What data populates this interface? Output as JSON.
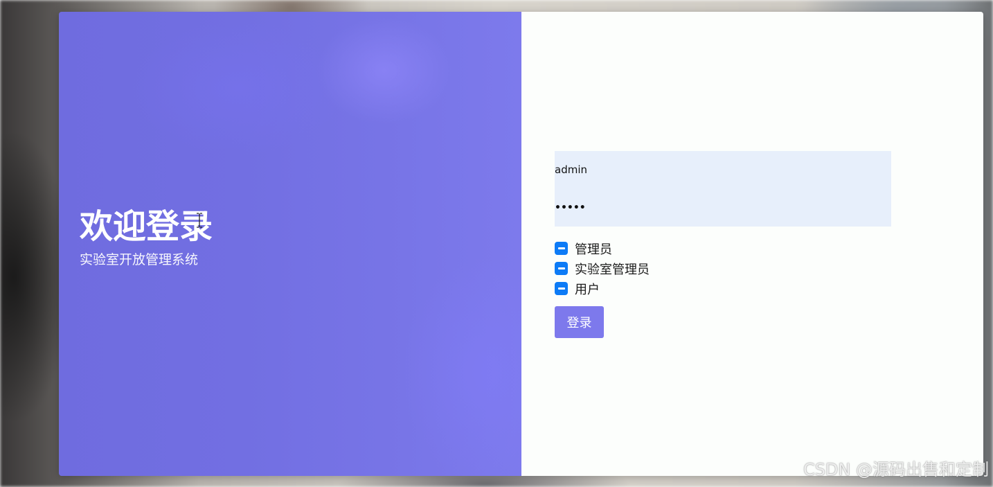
{
  "welcome": {
    "title": "欢迎登录",
    "subtitle": "实验室开放管理系统"
  },
  "login_form": {
    "username_value": "admin",
    "password_value": "•••••",
    "roles": [
      {
        "label": "管理员",
        "state": "indeterminate"
      },
      {
        "label": "实验室管理员",
        "state": "indeterminate"
      },
      {
        "label": "用户",
        "state": "indeterminate"
      }
    ],
    "submit_label": "登录"
  },
  "colors": {
    "left_panel": "#726fe2",
    "checkbox": "#0d7bf6",
    "button": "#7d79ec",
    "field_bg": "#e7effb"
  },
  "watermark": "CSDN @源码出售和定制"
}
